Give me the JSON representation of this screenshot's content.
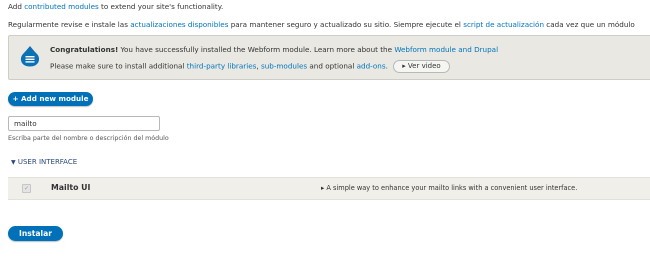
{
  "intro": {
    "line1_pre": "Add ",
    "line1_link": "contributed modules",
    "line1_post": " to extend your site's functionality.",
    "line2_pre": "Regularmente revise e instale las ",
    "line2_link1": "actualizaciones disponibles",
    "line2_mid": " para mantener seguro y actualizado su sitio. Siempre ejecute el ",
    "line2_link2": "script de actualización",
    "line2_post": " cada vez que un módulo"
  },
  "message": {
    "strong": "Congratulations!",
    "line1_text": " You have successfully installed the Webform module. Learn more about the ",
    "line1_link": "Webform module and Drupal",
    "line2_pre": "Please make sure to install additional ",
    "link_libraries": "third-party libraries",
    "sep1": ", ",
    "link_submodules": "sub-modules",
    "mid": " and optional ",
    "link_addons": "add-ons",
    "end": ".",
    "video_button": "▸ Ver video",
    "icon": "drupal-drop-icon"
  },
  "add_module_button": "+ Add new module",
  "filter": {
    "value": "mailto",
    "description": "Escriba parte del nombre o descripción del módulo"
  },
  "category": {
    "toggle": "▼",
    "title": "USER INTERFACE"
  },
  "modules": [
    {
      "name": "Mailto UI",
      "checked": true,
      "description": "▸  A simple way to enhance your mailto links with a convenient user interface."
    }
  ],
  "install_button": "Instalar",
  "colors": {
    "link": "#0074bd",
    "button": "#0071b8",
    "message_bg": "#e9e8e2"
  }
}
